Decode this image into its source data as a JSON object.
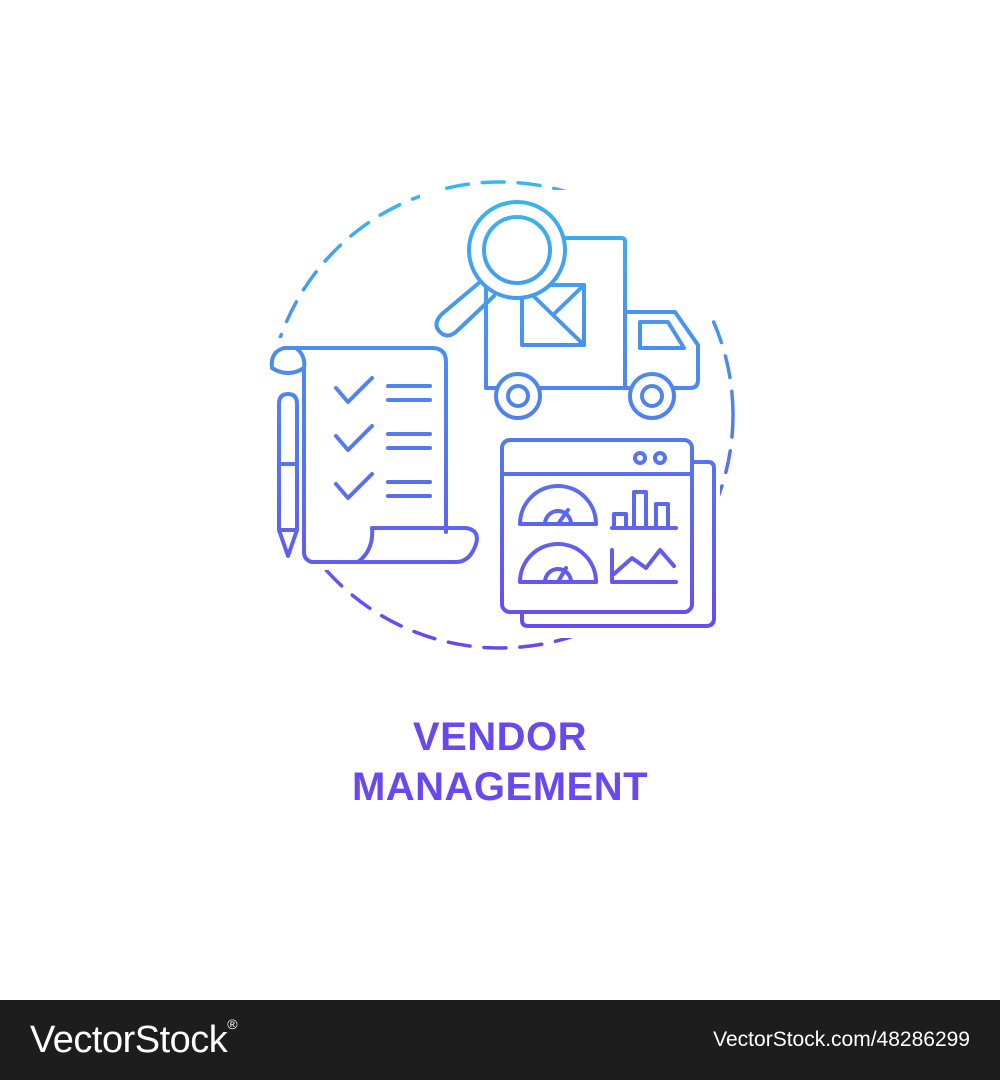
{
  "illustration": {
    "title_line_1": "VENDOR",
    "title_line_2": "MANAGEMENT",
    "gradient_top_color": "#3ab7ee",
    "gradient_bottom_color": "#6a48f0",
    "icons": [
      "magnifier-icon",
      "delivery-truck-icon",
      "checklist-scroll-icon",
      "pen-icon",
      "dashboard-window-icon"
    ]
  },
  "watermark": {
    "logo": "VectorStock",
    "registered_mark": "®",
    "url": "VectorStock.com/48286299",
    "background_color": "#1d1d1d"
  }
}
